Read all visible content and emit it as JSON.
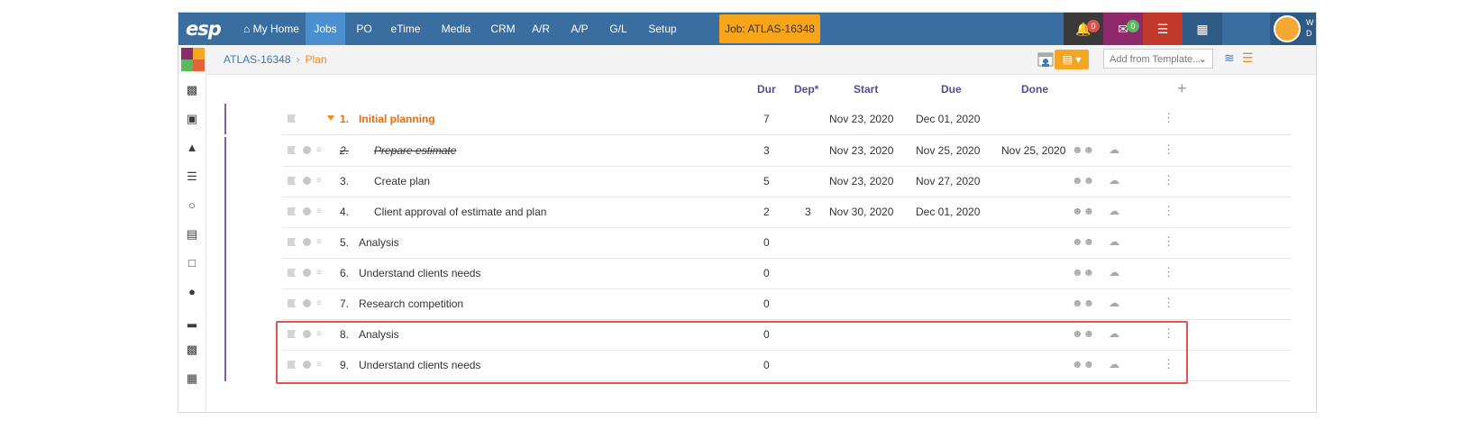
{
  "nav": {
    "logo": "esp",
    "items": [
      {
        "label": "⌂ My Home",
        "active": false
      },
      {
        "label": "Jobs",
        "active": true
      },
      {
        "label": "PO",
        "active": false
      },
      {
        "label": "eTime",
        "active": false
      },
      {
        "label": "Media",
        "active": false
      },
      {
        "label": "CRM",
        "active": false
      },
      {
        "label": "A/R",
        "active": false
      },
      {
        "label": "A/P",
        "active": false
      },
      {
        "label": "G/L",
        "active": false
      },
      {
        "label": "Setup",
        "active": false
      }
    ],
    "job_button": "Job: ATLAS-16348",
    "notifications_count": "0",
    "messages_count": "0",
    "avatar_text_1": "W",
    "avatar_text_2": "D",
    "colors": {
      "nav_bg": "#3a6da0",
      "active": "#4a8fd0",
      "job": "#f9a51a",
      "bell": "#3a3a3a",
      "mail": "#8e2a6b",
      "db": "#c0392b",
      "book": "#2e5a86"
    }
  },
  "breadcrumb": {
    "parent": "ATLAS-16348",
    "separator": "›",
    "current": "Plan"
  },
  "toolbar": {
    "template_placeholder": "Add from Template...",
    "template_chevron": "⌄"
  },
  "sidebar_icons": [
    "sitemap-icon",
    "image-icon",
    "folder-icon",
    "list-icon",
    "chat-icon",
    "map-icon",
    "calendar-icon",
    "users-icon",
    "signal-icon",
    "money-icon",
    "calendar-grid-icon"
  ],
  "table": {
    "headers": {
      "dur": "Dur",
      "dep": "Dep*",
      "start": "Start",
      "due": "Due",
      "done": "Done",
      "add": "+"
    },
    "rows": [
      {
        "num": "1.",
        "name": "Initial planning",
        "dur": "7",
        "dep": "",
        "start": "Nov 23, 2020",
        "due": "Dec 01, 2020",
        "done": "",
        "type": "group"
      },
      {
        "num": "2.",
        "name": "Prepare estimate",
        "dur": "3",
        "dep": "",
        "start": "Nov 23, 2020",
        "due": "Nov 25, 2020",
        "done": "Nov 25, 2020",
        "type": "done"
      },
      {
        "num": "3.",
        "name": "Create plan",
        "dur": "5",
        "dep": "",
        "start": "Nov 23, 2020",
        "due": "Nov 27, 2020",
        "done": "",
        "type": "child"
      },
      {
        "num": "4.",
        "name": "Client approval of estimate and plan",
        "dur": "2",
        "dep": "3",
        "start": "Nov 30, 2020",
        "due": "Dec 01, 2020",
        "done": "",
        "type": "child"
      },
      {
        "num": "5.",
        "name": "Analysis",
        "dur": "0",
        "dep": "",
        "start": "",
        "due": "",
        "done": "",
        "type": "task"
      },
      {
        "num": "6.",
        "name": "Understand clients needs",
        "dur": "0",
        "dep": "",
        "start": "",
        "due": "",
        "done": "",
        "type": "task"
      },
      {
        "num": "7.",
        "name": "Research competition",
        "dur": "0",
        "dep": "",
        "start": "",
        "due": "",
        "done": "",
        "type": "task"
      },
      {
        "num": "8.",
        "name": "Analysis",
        "dur": "0",
        "dep": "",
        "start": "",
        "due": "",
        "done": "",
        "type": "task"
      },
      {
        "num": "9.",
        "name": "Understand clients needs",
        "dur": "0",
        "dep": "",
        "start": "",
        "due": "",
        "done": "",
        "type": "task"
      }
    ]
  },
  "highlight_color": "#e05454"
}
